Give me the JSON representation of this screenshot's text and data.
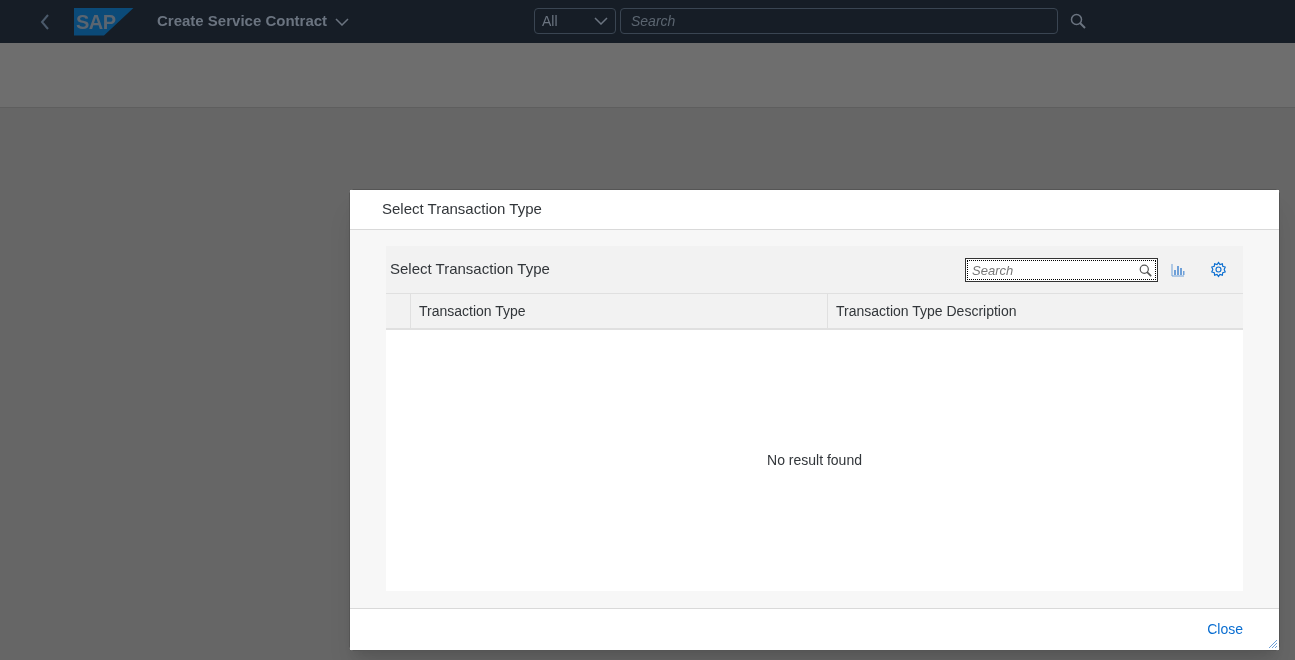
{
  "shell_bar": {
    "logo": "SAP",
    "title": "Create Service Contract",
    "search_scope": "All",
    "search": {
      "placeholder": "Search"
    }
  },
  "dialog": {
    "title": "Select Transaction Type",
    "table": {
      "title": "Select Transaction Type",
      "search": {
        "placeholder": "Search"
      },
      "columns": [
        "Transaction Type",
        "Transaction Type Description"
      ],
      "empty_text": "No result found"
    },
    "buttons": [
      "Close"
    ]
  }
}
